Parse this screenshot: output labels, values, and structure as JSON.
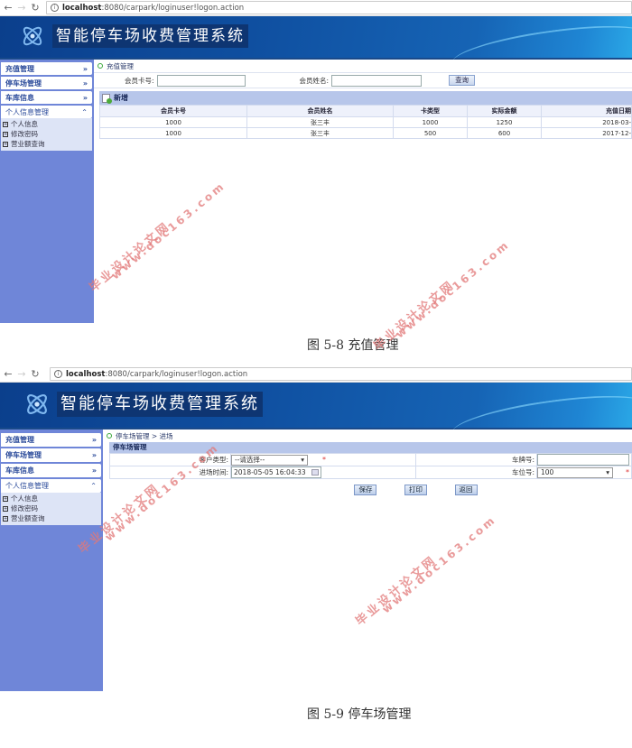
{
  "browser": {
    "url_host": "localhost",
    "url_rest": ":8080/carpark/loginuser!logon.action"
  },
  "app": {
    "title": "智能停车场收费管理系统"
  },
  "sidebar": {
    "items": [
      {
        "label": "充值管理",
        "chevron": "»"
      },
      {
        "label": "停车场管理",
        "chevron": "»"
      },
      {
        "label": "车库信息",
        "chevron": "»"
      },
      {
        "label": "个人信息管理",
        "chevron": "⌃"
      }
    ],
    "submenu": [
      {
        "label": "个人信息"
      },
      {
        "label": "修改密码"
      },
      {
        "label": "营业额查询"
      }
    ]
  },
  "figure1": {
    "breadcrumb": "充值管理",
    "search": {
      "card_label": "会员卡号:",
      "card_value": "",
      "name_label": "会员姓名:",
      "name_value": "",
      "query_button": "查询"
    },
    "add_label": "新增",
    "table": {
      "columns": [
        "会员卡号",
        "会员姓名",
        "卡类型",
        "实际金额",
        "充值日期"
      ],
      "rows": [
        [
          "1000",
          "张三丰",
          "1000",
          "1250",
          "2018-03-"
        ],
        [
          "1000",
          "张三丰",
          "500",
          "600",
          "2017-12-"
        ]
      ]
    },
    "caption": "图 5-8 充值管理"
  },
  "figure2": {
    "breadcrumb": "停车场管理 > 进场",
    "form_title": "停车场管理",
    "fields": {
      "customer_type_label": "客户类型:",
      "customer_type_value": "--请选择--",
      "plate_label": "车牌号:",
      "plate_value": "",
      "entry_time_label": "进场时间:",
      "entry_time_value": "2018-05-05 16:04:33",
      "slot_label": "车位号:",
      "slot_value": "100"
    },
    "required_mark": "*",
    "buttons": {
      "save": "保存",
      "print": "打印",
      "back": "返回"
    },
    "caption": "图 5-9 停车场管理"
  },
  "watermark": {
    "line1": "毕业设计论文网",
    "line2": "www.doc163.com"
  }
}
